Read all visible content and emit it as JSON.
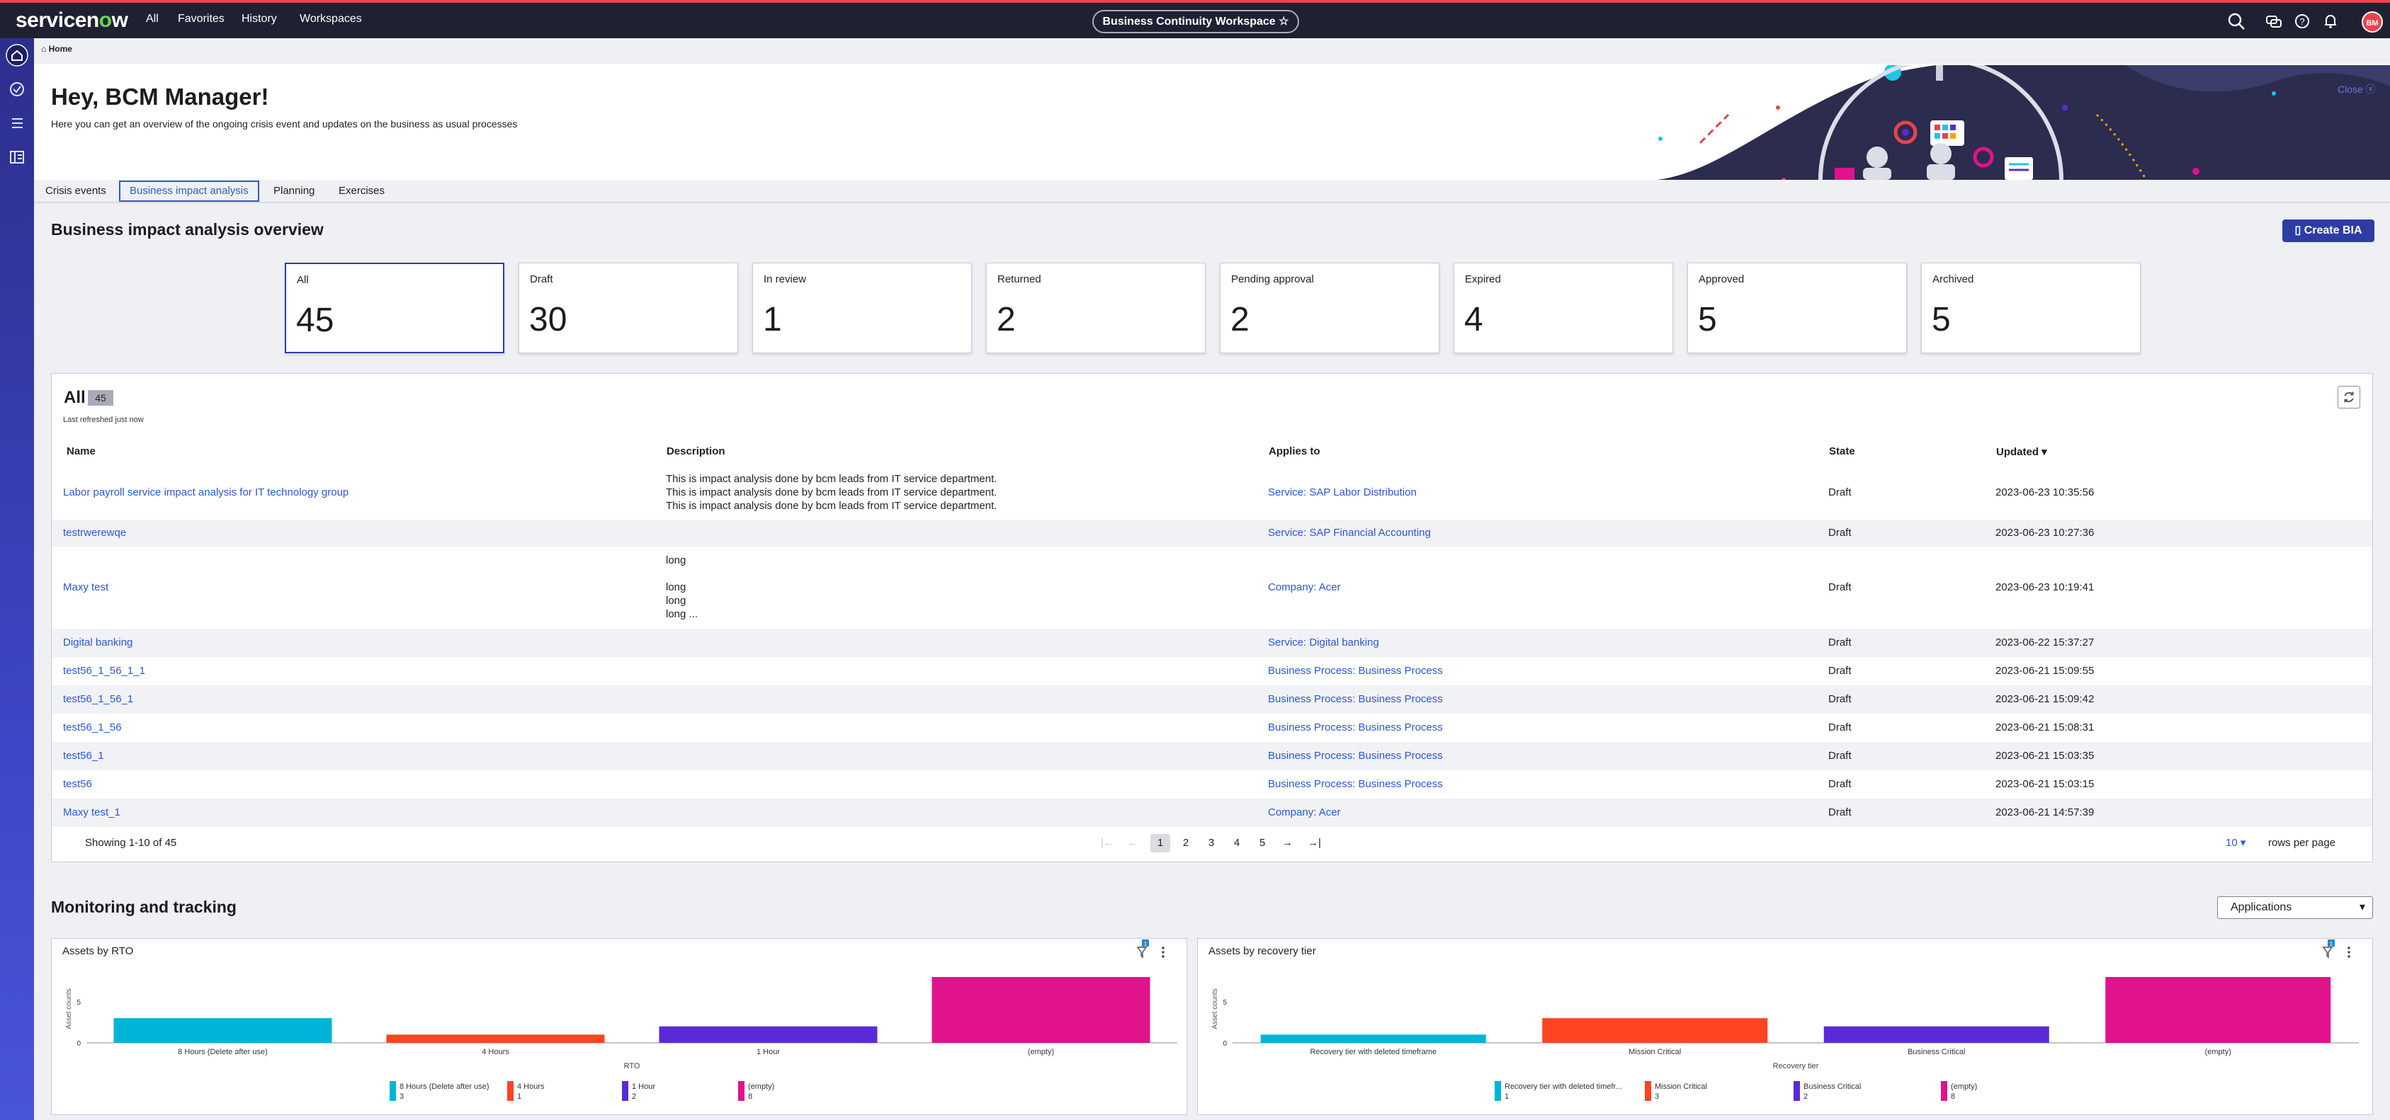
{
  "topbar": {
    "logo": "servicenow",
    "nav": [
      "All",
      "Favorites",
      "History",
      "Workspaces"
    ],
    "workspace": "Business Continuity Workspace ☆",
    "avatar": "BM"
  },
  "breadcrumb": "Home",
  "hero": {
    "title": "Hey, BCM Manager!",
    "subtitle": "Here you can get an overview of the ongoing crisis event and updates on the business as usual processes",
    "close": "Close"
  },
  "tabs": [
    "Crisis events",
    "Business impact analysis",
    "Planning",
    "Exercises"
  ],
  "bia": {
    "title": "Business impact analysis overview",
    "create_label": "Create BIA",
    "cards": [
      {
        "label": "All",
        "value": "45"
      },
      {
        "label": "Draft",
        "value": "30"
      },
      {
        "label": "In review",
        "value": "1"
      },
      {
        "label": "Returned",
        "value": "2"
      },
      {
        "label": "Pending approval",
        "value": "2"
      },
      {
        "label": "Expired",
        "value": "4"
      },
      {
        "label": "Approved",
        "value": "5"
      },
      {
        "label": "Archived",
        "value": "5"
      }
    ]
  },
  "list": {
    "title": "All",
    "count": "45",
    "refreshed": "Last refreshed just now",
    "columns": [
      "Name",
      "Description",
      "Applies to",
      "State",
      "Updated"
    ],
    "rows": [
      {
        "name": "Labor payroll service impact analysis for IT technology group",
        "desc": [
          "This is impact analysis done by bcm leads from IT service department.",
          "This is impact analysis done by bcm leads from IT service department.",
          "This is impact analysis done by bcm leads from IT service department."
        ],
        "applies": "Service: SAP Labor Distribution",
        "state": "Draft",
        "updated": "2023-06-23 10:35:56"
      },
      {
        "name": "testrwerewqe",
        "desc": [],
        "applies": "Service: SAP Financial Accounting",
        "state": "Draft",
        "updated": "2023-06-23 10:27:36"
      },
      {
        "name": "Maxy test",
        "desc": [
          "long",
          "",
          "long",
          "long",
          "long ..."
        ],
        "applies": "Company: Acer",
        "state": "Draft",
        "updated": "2023-06-23 10:19:41"
      },
      {
        "name": "Digital banking",
        "desc": [],
        "applies": "Service: Digital banking",
        "state": "Draft",
        "updated": "2023-06-22 15:37:27"
      },
      {
        "name": "test56_1_56_1_1",
        "desc": [],
        "applies": "Business Process: Business Process",
        "state": "Draft",
        "updated": "2023-06-21 15:09:55"
      },
      {
        "name": "test56_1_56_1",
        "desc": [],
        "applies": "Business Process: Business Process",
        "state": "Draft",
        "updated": "2023-06-21 15:09:42"
      },
      {
        "name": "test56_1_56",
        "desc": [],
        "applies": "Business Process: Business Process",
        "state": "Draft",
        "updated": "2023-06-21 15:08:31"
      },
      {
        "name": "test56_1",
        "desc": [],
        "applies": "Business Process: Business Process",
        "state": "Draft",
        "updated": "2023-06-21 15:03:35"
      },
      {
        "name": "test56",
        "desc": [],
        "applies": "Business Process: Business Process",
        "state": "Draft",
        "updated": "2023-06-21 15:03:15"
      },
      {
        "name": "Maxy test_1",
        "desc": [],
        "applies": "Company: Acer",
        "state": "Draft",
        "updated": "2023-06-21 14:57:39"
      }
    ],
    "showing": "Showing 1-10 of 45",
    "pages": [
      "1",
      "2",
      "3",
      "4",
      "5"
    ],
    "current_page": "1",
    "rows_per_page": "10",
    "rows_per_page_label": "rows per page"
  },
  "monitoring": {
    "title": "Monitoring and tracking",
    "filter_select": "Applications",
    "filter_badge": "1"
  },
  "colors": {
    "accent": "#2e3da6",
    "link": "#2b57d4",
    "topbar": "#1f2133",
    "bar_cyan": "#00b4d8",
    "bar_red": "#ff4422",
    "bar_purple": "#5a2ad8",
    "bar_magenta": "#e0128c"
  },
  "chart_data": [
    {
      "type": "bar",
      "title": "Assets by RTO",
      "xlabel": "RTO",
      "ylabel": "Asset counts",
      "categories": [
        "8 Hours (Delete after use)",
        "4 Hours",
        "1 Hour",
        "(empty)"
      ],
      "values": [
        3,
        1,
        2,
        8
      ],
      "legend": [
        {
          "label": "8 Hours (Delete after use)",
          "value": "3"
        },
        {
          "label": "4 Hours",
          "value": "1"
        },
        {
          "label": "1 Hour",
          "value": "2"
        },
        {
          "label": "(empty)",
          "value": "8"
        }
      ],
      "yticks": [
        "0",
        "5"
      ],
      "ylim": [
        0,
        8
      ],
      "grid": false
    },
    {
      "type": "bar",
      "title": "Assets by recovery tier",
      "xlabel": "Recovery tier",
      "ylabel": "Asset counts",
      "categories": [
        "Recovery tier with deleted timeframe",
        "Mission Critical",
        "Business Critical",
        "(empty)"
      ],
      "values": [
        1,
        3,
        2,
        8
      ],
      "legend": [
        {
          "label": "Recovery tier with deleted timefr...",
          "value": "1"
        },
        {
          "label": "Mission Critical",
          "value": "3"
        },
        {
          "label": "Business Critical",
          "value": "2"
        },
        {
          "label": "(empty)",
          "value": "8"
        }
      ],
      "yticks": [
        "0",
        "5"
      ],
      "ylim": [
        0,
        8
      ],
      "grid": false
    }
  ]
}
